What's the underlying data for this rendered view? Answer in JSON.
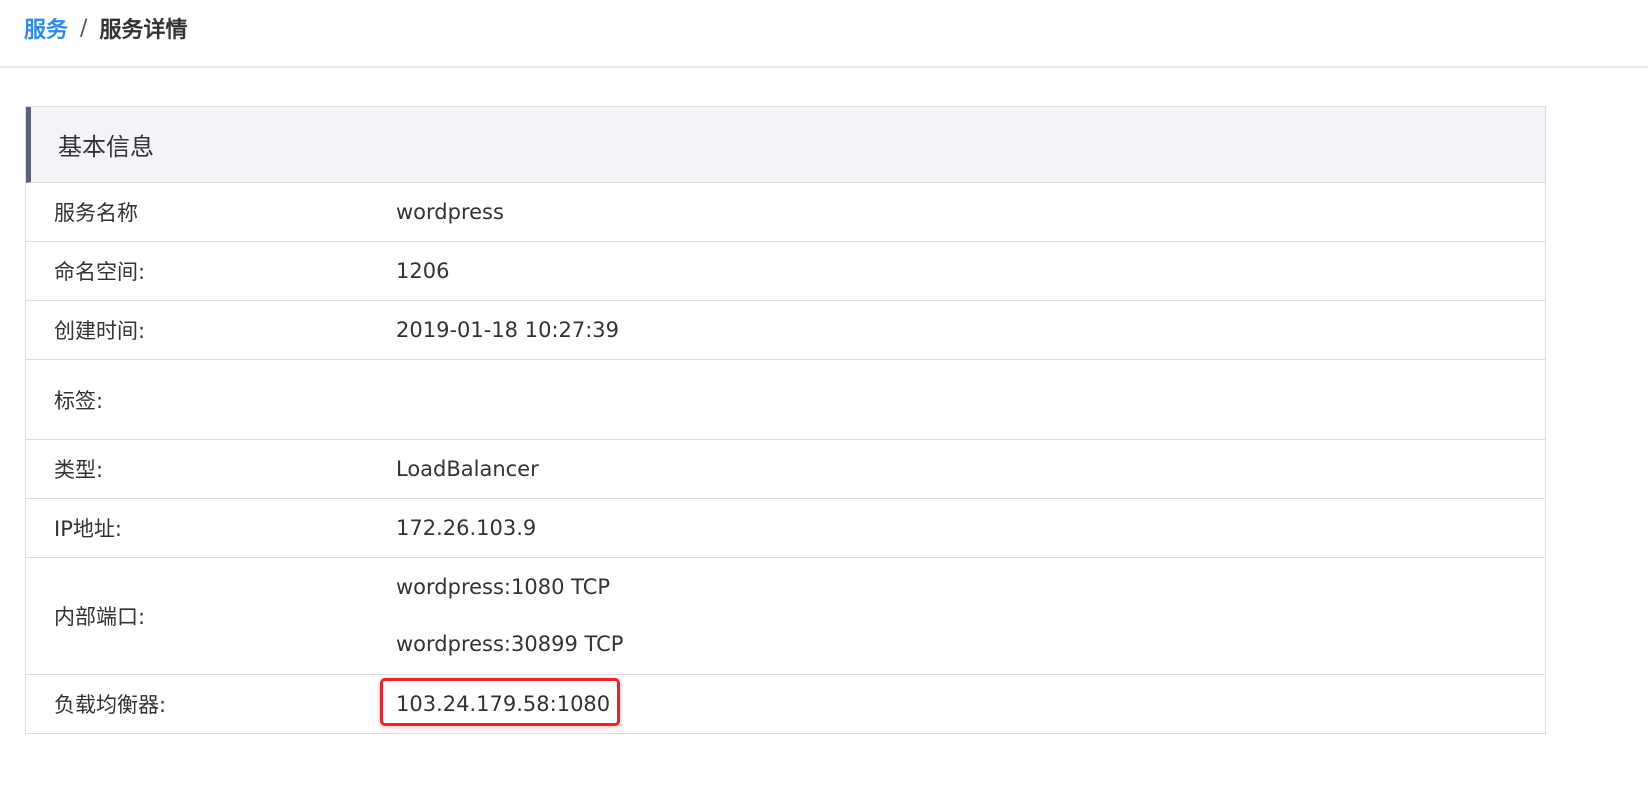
{
  "breadcrumb": {
    "parent": "服务",
    "separator": "/",
    "current": "服务详情"
  },
  "panel": {
    "title": "基本信息",
    "rows": [
      {
        "label": "服务名称",
        "value": "wordpress"
      },
      {
        "label": "命名空间:",
        "value": "1206"
      },
      {
        "label": "创建时间:",
        "value": "2019-01-18 10:27:39"
      },
      {
        "label": "标签:",
        "value": ""
      },
      {
        "label": "类型:",
        "value": "LoadBalancer"
      },
      {
        "label": "IP地址:",
        "value": "172.26.103.9"
      },
      {
        "label": "内部端口:",
        "values": [
          "wordpress:1080 TCP",
          "wordpress:30899 TCP"
        ]
      },
      {
        "label": "负载均衡器:",
        "value": "103.24.179.58:1080"
      }
    ]
  },
  "colors": {
    "link": "#2d8cf0",
    "highlight": "#e8262a",
    "header_bar": "#5c6177"
  }
}
